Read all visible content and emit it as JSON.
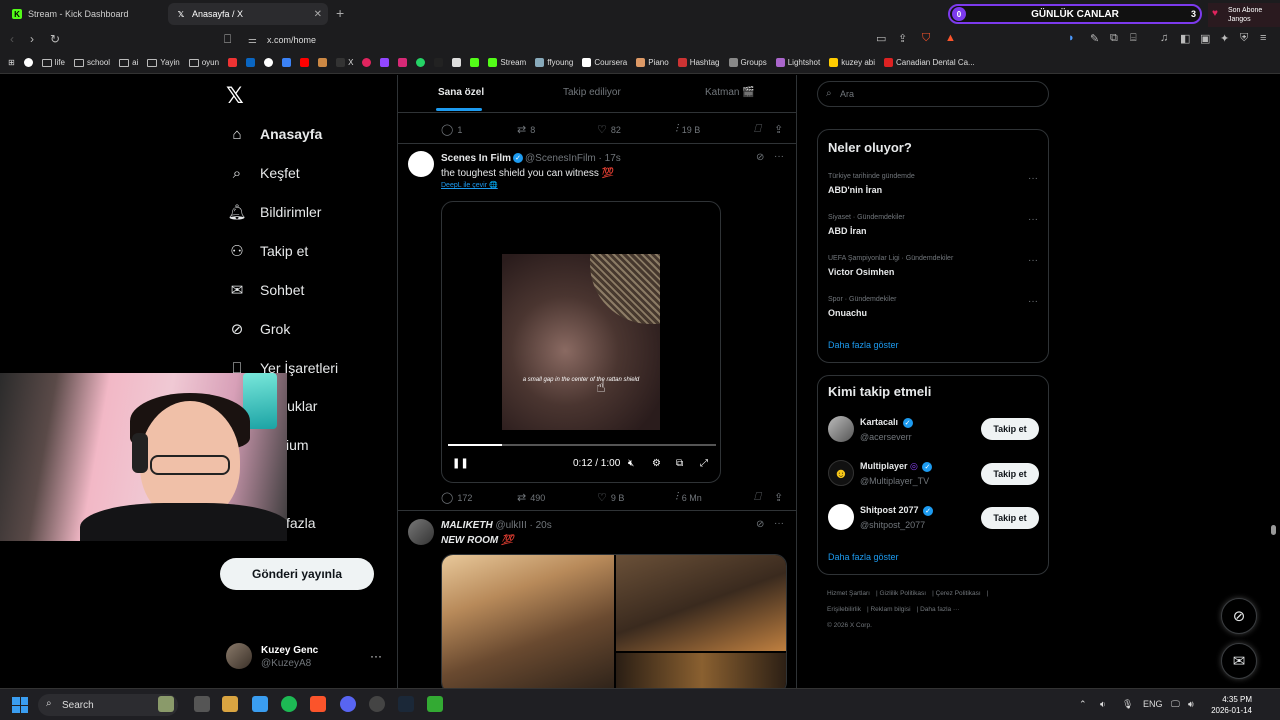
{
  "browser": {
    "tabs": [
      {
        "title": "Stream - Kick Dashboard",
        "icon": "kick-icon",
        "active": false
      },
      {
        "title": "Anasayfa / X",
        "icon": "x-icon",
        "active": true
      }
    ],
    "url": "x.com/home",
    "bookmarks": [
      "life",
      "school",
      "ai",
      "Yayin",
      "oyun",
      "X",
      "Stream",
      "ffyoung",
      "Coursera",
      "Piano",
      "Hashtag",
      "Groups",
      "Lightshot",
      "kuzey abi",
      "Canadian Dental Ca..."
    ]
  },
  "stream_widget": {
    "left_count": "0",
    "title": "GÜNLÜK CANLAR",
    "right_count": "3",
    "sub_label": "Son Abone",
    "sub_name": "Jangos"
  },
  "nav": {
    "items": [
      {
        "label": "Anasayfa",
        "icon": "home-icon"
      },
      {
        "label": "Keşfet",
        "icon": "search-icon"
      },
      {
        "label": "Bildirimler",
        "icon": "bell-icon"
      },
      {
        "label": "Takip et",
        "icon": "person-add-icon"
      },
      {
        "label": "Sohbet",
        "icon": "mail-icon"
      },
      {
        "label": "Grok",
        "icon": "grok-icon"
      },
      {
        "label": "Yer İşaretleri",
        "icon": "bookmark-icon"
      },
      {
        "label": "luklar",
        "icon": "list-icon"
      },
      {
        "label": "ium",
        "icon": "premium-icon"
      },
      {
        "label": "fazla",
        "icon": "more-icon"
      }
    ],
    "post_button": "Gönderi yayınla",
    "account": {
      "name": "Kuzey Genc",
      "handle": "@KuzeyA8"
    }
  },
  "timeline": {
    "tabs": [
      "Sana özel",
      "Takip ediliyor",
      "Katman 🎬"
    ],
    "prev_actions": {
      "replies": "1",
      "reposts": "8",
      "likes": "82",
      "views": "19 B"
    },
    "tweet1": {
      "name": "Scenes In Film",
      "handle": "@ScenesInFilm · 17s",
      "text": "the toughest shield you can witness 💯",
      "translate": "DeepL ile çevir 🌐",
      "caption": "a small gap in the center of the rattan shield",
      "time": "0:12 / 1:00",
      "progress": 0.2,
      "actions": {
        "replies": "172",
        "reposts": "490",
        "likes": "9 B",
        "views": "6 Mn"
      }
    },
    "tweet2": {
      "name": "MALIKETH",
      "handle": "@ulkIII · 20s",
      "text": "NEW ROOM 💯"
    }
  },
  "sidebar": {
    "search_placeholder": "Ara",
    "trends_title": "Neler oluyor?",
    "trends": [
      {
        "category": "Türkiye tarihinde gündemde",
        "name": "ABD'nin İran"
      },
      {
        "category": "Siyaset · Gündemdekiler",
        "name": "ABD İran"
      },
      {
        "category": "UEFA Şampiyonlar Ligi · Gündemdekiler",
        "name": "Victor Osimhen"
      },
      {
        "category": "Spor · Gündemdekiler",
        "name": "Onuachu"
      }
    ],
    "show_more": "Daha fazla göster",
    "wtf_title": "Kimi takip etmeli",
    "who_to_follow": [
      {
        "name": "Kartacalı",
        "handle": "@acerseverr",
        "button": "Takip et"
      },
      {
        "name": "Multiplayer",
        "handle": "@Multiplayer_TV",
        "button": "Takip et"
      },
      {
        "name": "Shitpost 2077",
        "handle": "@shitpost_2077",
        "button": "Takip et"
      }
    ],
    "footer": [
      "Hizmet Şartları",
      "Gizlilik Politikası",
      "Çerez Politikası",
      "Erişilebilirlik",
      "Reklam bilgisi",
      "Daha fazla ···",
      "© 2026 X Corp."
    ]
  },
  "taskbar": {
    "search": "Search",
    "lang": "ENG",
    "time": "4:35 PM",
    "date": "2026-01-14"
  }
}
